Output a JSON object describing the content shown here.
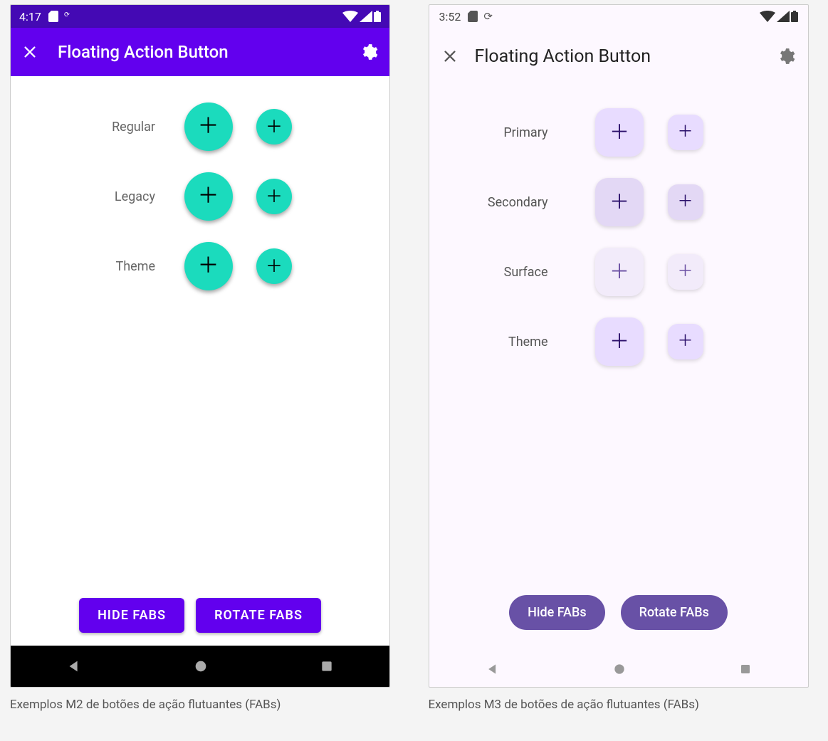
{
  "m2": {
    "status_time": "4:17",
    "appbar_title": "Floating Action Button",
    "rows": [
      {
        "label": "Regular"
      },
      {
        "label": "Legacy"
      },
      {
        "label": "Theme"
      }
    ],
    "buttons": {
      "hide": "HIDE FABS",
      "rotate": "ROTATE FABS"
    },
    "caption": "Exemplos M2 de botões de ação flutuantes (FABs)",
    "colors": {
      "appbar": "#6200ee",
      "fab": "#1bdbbd"
    }
  },
  "m3": {
    "status_time": "3:52",
    "appbar_title": "Floating Action Button",
    "rows": [
      {
        "label": "Primary",
        "style": "m3-primary"
      },
      {
        "label": "Secondary",
        "style": "m3-secondary"
      },
      {
        "label": "Surface",
        "style": "m3-surface"
      },
      {
        "label": "Theme",
        "style": "m3-theme"
      }
    ],
    "buttons": {
      "hide": "Hide FABs",
      "rotate": "Rotate FABs"
    },
    "caption": "Exemplos M3 de botões de ação flutuantes (FABs)",
    "colors": {
      "button": "#6851a6",
      "fab_primary": "#e8dcff"
    }
  }
}
